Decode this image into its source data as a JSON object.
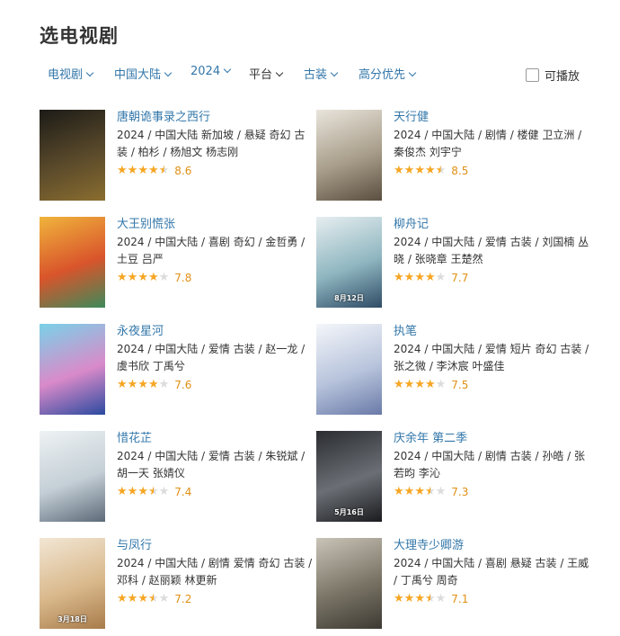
{
  "page_title": "选电视剧",
  "filters": [
    {
      "label": "电视剧",
      "has_chevron": true,
      "style": "link"
    },
    {
      "label": "中国大陆",
      "has_chevron": true,
      "style": "link"
    },
    {
      "label": "2024",
      "has_chevron": true,
      "style": "link"
    },
    {
      "label": "平台",
      "has_chevron": true,
      "style": "dark"
    },
    {
      "label": "古装",
      "has_chevron": true,
      "style": "link"
    },
    {
      "label": "高分优先",
      "has_chevron": true,
      "style": "link"
    }
  ],
  "playable": {
    "label": "可播放",
    "checked": false
  },
  "shows": [
    {
      "title": "唐朝诡事录之西行",
      "meta": "2024 / 中国大陆 新加坡 / 悬疑 奇幻 古装 / 柏杉 / 杨旭文 杨志刚",
      "stars": 4.5,
      "score": "8.6",
      "poster_colors": [
        "#1c1b17",
        "#5a4a2b",
        "#8a6d2f"
      ],
      "poster_text": ""
    },
    {
      "title": "天行健",
      "meta": "2024 / 中国大陆 / 剧情 / 楼健 卫立洲 / 秦俊杰 刘宇宁",
      "stars": 4.5,
      "score": "8.5",
      "poster_colors": [
        "#e9e5dc",
        "#a89d8a",
        "#5a4f40"
      ],
      "poster_text": ""
    },
    {
      "title": "大王别慌张",
      "meta": "2024 / 中国大陆 / 喜剧 奇幻 / 金哲勇 / 土豆 吕严",
      "stars": 4,
      "score": "7.8",
      "poster_colors": [
        "#f0b43c",
        "#d9542b",
        "#3d8a5a"
      ],
      "poster_text": ""
    },
    {
      "title": "柳舟记",
      "meta": "2024 / 中国大陆 / 爱情 古装 / 刘国楠 丛晓 / 张晓章 王楚然",
      "stars": 4,
      "score": "7.7",
      "poster_colors": [
        "#e6eef0",
        "#8fb6c0",
        "#2f4c66"
      ],
      "poster_text": "8月12日"
    },
    {
      "title": "永夜星河",
      "meta": "2024 / 中国大陆 / 爱情 古装 / 赵一龙 / 虞书欣 丁禹兮",
      "stars": 4,
      "score": "7.6",
      "poster_colors": [
        "#7ad1e8",
        "#d98ac9",
        "#2b4aa0"
      ],
      "poster_text": ""
    },
    {
      "title": "执笔",
      "meta": "2024 / 中国大陆 / 爱情 短片 奇幻 古装 / 张之微 / 李沐宸 叶盛佳",
      "stars": 4,
      "score": "7.5",
      "poster_colors": [
        "#f4f6fa",
        "#b8c4dc",
        "#6a7aa8"
      ],
      "poster_text": ""
    },
    {
      "title": "惜花芷",
      "meta": "2024 / 中国大陆 / 爱情 古装 / 朱锐斌 / 胡一天 张婧仪",
      "stars": 3.5,
      "score": "7.4",
      "poster_colors": [
        "#eef2f4",
        "#c4cfd6",
        "#5d6a78"
      ],
      "poster_text": ""
    },
    {
      "title": "庆余年 第二季",
      "meta": "2024 / 中国大陆 / 剧情 古装 / 孙皓 / 张若昀 李沁",
      "stars": 3.5,
      "score": "7.3",
      "poster_colors": [
        "#2a2c30",
        "#6b6f75",
        "#1a1b1e"
      ],
      "poster_text": "5月16日"
    },
    {
      "title": "与凤行",
      "meta": "2024 / 中国大陆 / 剧情 爱情 奇幻 古装 / 邓科 / 赵丽颖 林更新",
      "stars": 3.5,
      "score": "7.2",
      "poster_colors": [
        "#f2e6d4",
        "#d9b98c",
        "#a87b4a"
      ],
      "poster_text": "3月18日"
    },
    {
      "title": "大理寺少卿游",
      "meta": "2024 / 中国大陆 / 喜剧 悬疑 古装 / 王威 / 丁禹兮 周奇",
      "stars": 3.5,
      "score": "7.1",
      "poster_colors": [
        "#c9c4b8",
        "#7a7466",
        "#3d3a33"
      ],
      "poster_text": ""
    }
  ]
}
